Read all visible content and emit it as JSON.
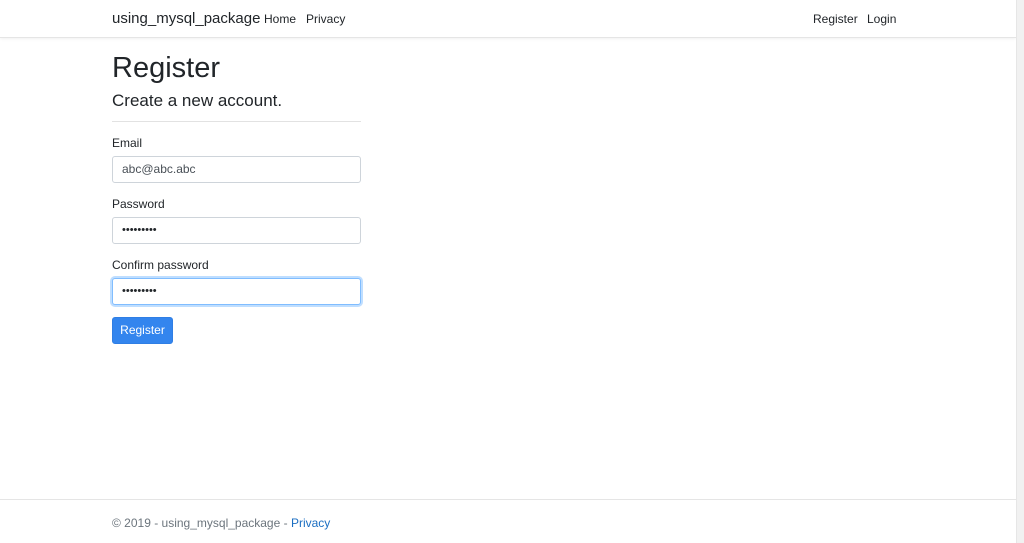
{
  "navbar": {
    "brand": "using_mysql_package",
    "links": [
      {
        "label": "Home"
      },
      {
        "label": "Privacy"
      }
    ],
    "account_links": [
      {
        "label": "Register"
      },
      {
        "label": "Login"
      }
    ]
  },
  "main": {
    "title": "Register",
    "subtitle": "Create a new account.",
    "form": {
      "email": {
        "label": "Email",
        "value": "abc@abc.abc"
      },
      "password": {
        "label": "Password",
        "value": "•••••••••"
      },
      "confirm": {
        "label": "Confirm password",
        "value": "•••••••••"
      },
      "submit_label": "Register"
    }
  },
  "footer": {
    "text": "© 2019 - using_mysql_package - ",
    "link_label": "Privacy"
  },
  "colors": {
    "primary_button": "#3385ee",
    "link": "#1b6ec2",
    "focus_border": "#80bdff"
  }
}
